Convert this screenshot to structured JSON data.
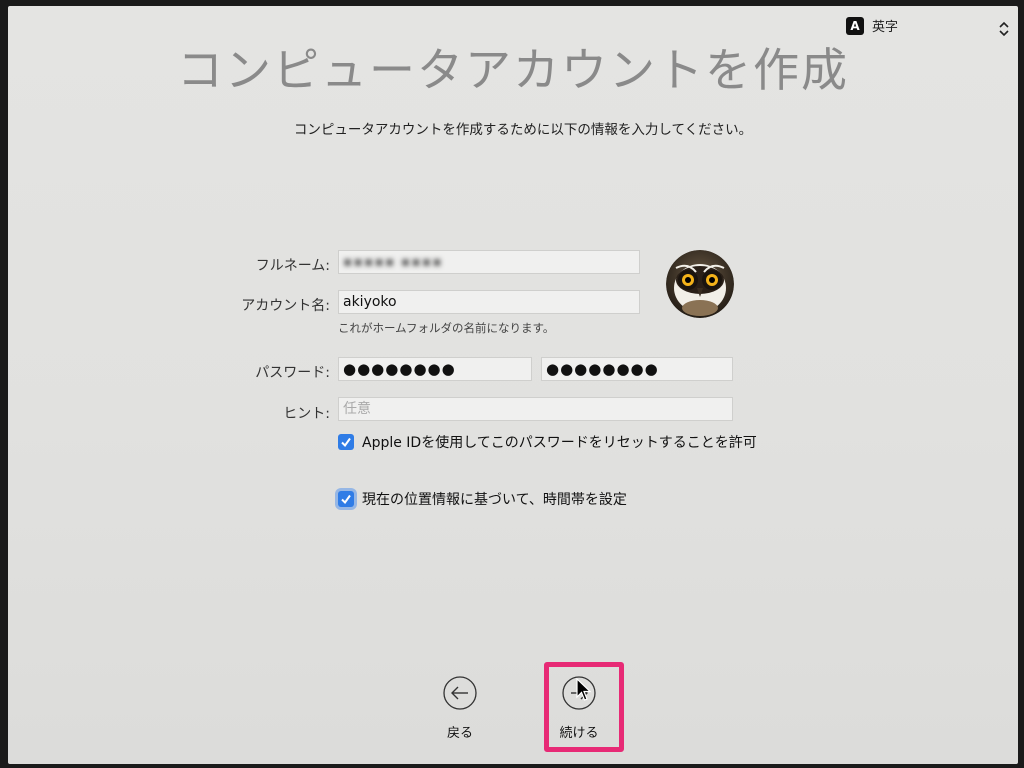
{
  "input_menu": {
    "badge": "A",
    "label": "英字"
  },
  "title": "コンピュータアカウントを作成",
  "subtitle": "コンピュータアカウントを作成するために以下の情報を入力してください。",
  "form": {
    "fullname_label": "フルネーム:",
    "fullname_value": "▪▪▪▪▪ ▪▪▪▪",
    "account_label": "アカウント名:",
    "account_value": "akiyoko",
    "account_help": "これがホームフォルダの名前になります。",
    "password_label": "パスワード:",
    "password_value": "●●●●●●●●",
    "verify_value": "●●●●●●●●",
    "hint_label": "ヒント:",
    "hint_placeholder": "任意"
  },
  "checkboxes": {
    "apple_id_reset": {
      "label": "Apple IDを使用してこのパスワードをリセットすることを許可",
      "checked": true
    },
    "location_timezone": {
      "label": "現在の位置情報に基づいて、時間帯を設定",
      "checked": true
    }
  },
  "nav": {
    "back_label": "戻る",
    "continue_label": "続ける"
  },
  "colors": {
    "accent": "#2f7ce6",
    "highlight": "#e72a75",
    "title": "#8a8a8a"
  },
  "icons": {
    "avatar": "owl-avatar-icon",
    "back": "arrow-left-circle-icon",
    "continue": "arrow-right-circle-icon",
    "input_menu": "updown-chevron-icon",
    "checkmark": "checkmark-icon",
    "cursor": "mouse-pointer-icon"
  }
}
